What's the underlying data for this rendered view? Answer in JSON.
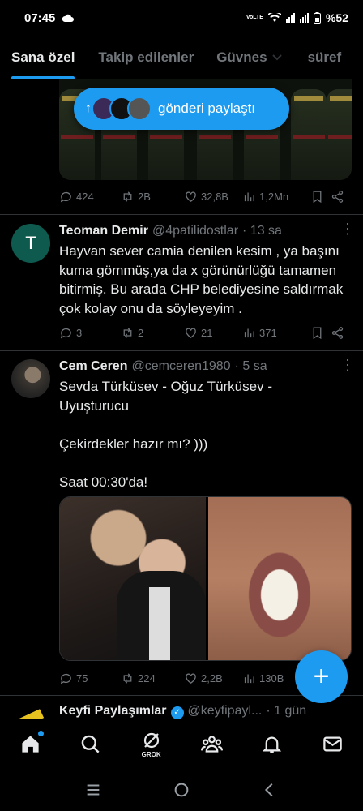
{
  "status": {
    "time": "07:45",
    "network": "VoLTE",
    "battery": "%52"
  },
  "tabs": [
    {
      "label": "Sana özel",
      "active": true
    },
    {
      "label": "Takip edilenler",
      "active": false
    },
    {
      "label": "Güvnes",
      "active": false
    },
    {
      "label": "süref",
      "active": false
    }
  ],
  "toast": {
    "label": "gönderi paylaştı"
  },
  "prev_post": {
    "replies": "424",
    "reposts": "2B",
    "likes": "32,8B",
    "views": "1,2Mn"
  },
  "tweet1": {
    "name": "Teoman Demir",
    "handle": "@4patilidostlar",
    "time": "· 13 sa",
    "avatar_letter": "T",
    "text": "Hayvan sever camia denilen kesim , ya başını kuma gömmüş,ya da x görünürlüğü tamamen bitirmiş. Bu arada CHP belediyesine saldırmak çok kolay onu da söyleyeyim .",
    "replies": "3",
    "reposts": "2",
    "likes": "21",
    "views": "371"
  },
  "tweet2": {
    "name": "Cem Ceren",
    "handle": "@cemceren1980",
    "time": "· 5 sa",
    "text": "Sevda Türküsev - Oğuz Türküsev -\nUyuşturucu\n\nÇekirdekler hazır mı? )))\n\nSaat 00:30'da!",
    "replies": "75",
    "reposts": "224",
    "likes": "2,2B",
    "views": "130B"
  },
  "tweet3": {
    "name": "Keyfi Paylaşımlar",
    "handle": "@keyfipayl...",
    "time": "· 1 gün"
  },
  "nav": {
    "grok_label": "GROK"
  },
  "colors": {
    "accent": "#1d9bf0",
    "muted": "#71767b",
    "text": "#e7e9ea",
    "divider": "#2f3336"
  },
  "icons": [
    "home-icon",
    "search-icon",
    "grok-icon",
    "communities-icon",
    "notifications-icon",
    "messages-icon",
    "reply-icon",
    "repost-icon",
    "like-icon",
    "views-icon",
    "bookmark-icon",
    "share-icon"
  ]
}
